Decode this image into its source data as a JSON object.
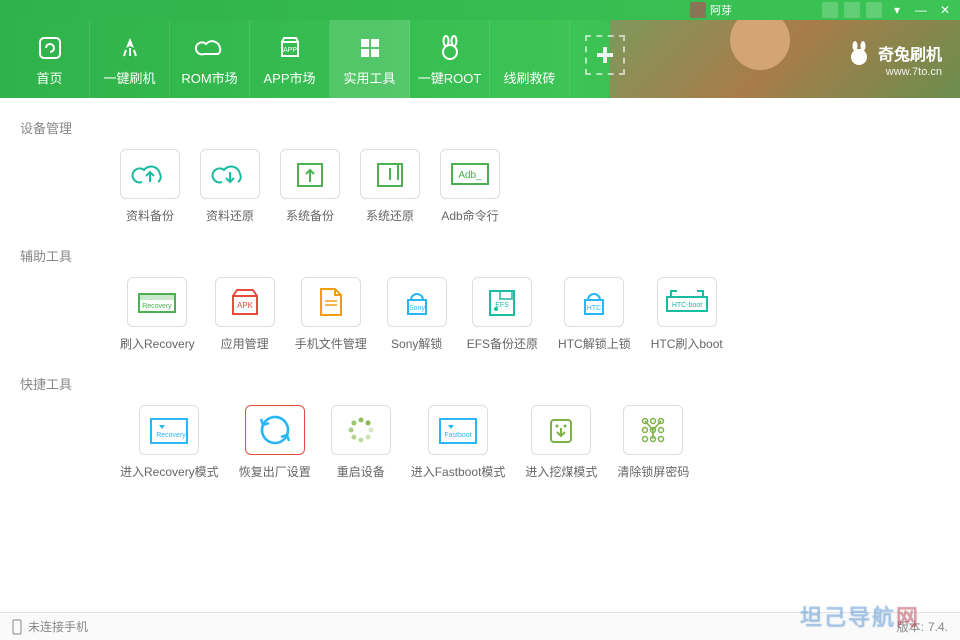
{
  "titlebar": {
    "username": "阿芽"
  },
  "brand": {
    "name_cn": "奇兔刷机",
    "url": "www.7to.cn"
  },
  "nav": [
    {
      "label": "首页",
      "icon": "refresh-icon"
    },
    {
      "label": "一键刷机",
      "icon": "rocket-icon"
    },
    {
      "label": "ROM市场",
      "icon": "cloud-icon"
    },
    {
      "label": "APP市场",
      "icon": "app-icon"
    },
    {
      "label": "实用工具",
      "icon": "grid-icon",
      "active": true
    },
    {
      "label": "一键ROOT",
      "icon": "bunny-icon"
    },
    {
      "label": "线刷救砖",
      "icon": "qr-icon"
    }
  ],
  "sections": [
    {
      "title": "设备管理",
      "tools": [
        {
          "label": "资料备份",
          "icon": "cloud-up",
          "color": "#1cbca0"
        },
        {
          "label": "资料还原",
          "icon": "cloud-down",
          "color": "#1cbca0"
        },
        {
          "label": "系统备份",
          "icon": "box-up",
          "color": "#4caf50"
        },
        {
          "label": "系统还原",
          "icon": "box-down",
          "color": "#4caf50"
        },
        {
          "label": "Adb命令行",
          "icon": "adb",
          "color": "#4caf50",
          "text": "Adb_"
        }
      ]
    },
    {
      "title": "辅助工具",
      "tools": [
        {
          "label": "刷入Recovery",
          "icon": "recovery-flash",
          "color": "#4caf50",
          "text": "Recovery"
        },
        {
          "label": "应用管理",
          "icon": "apk",
          "color": "#e74c3c",
          "text": "APK"
        },
        {
          "label": "手机文件管理",
          "icon": "file",
          "color": "#f39c12"
        },
        {
          "label": "Sony解锁",
          "icon": "lock-sony",
          "color": "#29b6f6",
          "text": "Sony"
        },
        {
          "label": "EFS备份还原",
          "icon": "disk-efs",
          "color": "#1cbca0",
          "text": "EFS"
        },
        {
          "label": "HTC解锁上锁",
          "icon": "lock-htc",
          "color": "#29b6f6",
          "text": "HTC"
        },
        {
          "label": "HTC刷入boot",
          "icon": "htc-boot",
          "color": "#1cbca0",
          "text": "HTC-boot"
        }
      ]
    },
    {
      "title": "快捷工具",
      "tools": [
        {
          "label": "进入Recovery模式",
          "icon": "enter-recovery",
          "color": "#29b6f6",
          "text": "Recovery"
        },
        {
          "label": "恢复出厂设置",
          "icon": "factory-reset",
          "color": "#29b6f6",
          "highlight": true
        },
        {
          "label": "重启设备",
          "icon": "reboot",
          "color": "#7cb342"
        },
        {
          "label": "进入Fastboot模式",
          "icon": "fastboot",
          "color": "#29b6f6",
          "text": "Fastboot"
        },
        {
          "label": "进入挖煤模式",
          "icon": "download-mode",
          "color": "#7cb342"
        },
        {
          "label": "清除锁屏密码",
          "icon": "clear-lock",
          "color": "#7cb342"
        }
      ]
    }
  ],
  "statusbar": {
    "connection": "未连接手机",
    "version_label": "版本:",
    "version": "7.4."
  },
  "watermark": {
    "blue": "坦己导航",
    "red": "网"
  }
}
